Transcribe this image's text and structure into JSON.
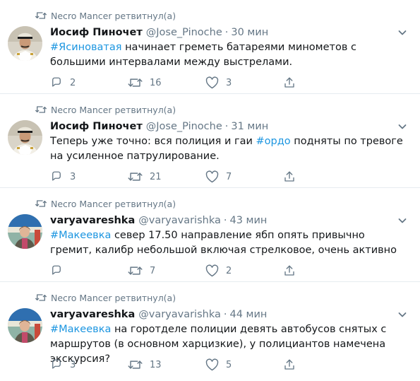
{
  "tweets": [
    {
      "retweeted_by": "Necro Mancer ретвитнул(а)",
      "name": "Иосиф Пиночет",
      "handle": "@Jose_Pinoche",
      "dot": "·",
      "time": "30 мин",
      "hashtag": "#Ясиноватая",
      "text_before": "",
      "text_after": " начинает  греметь батареями минометов с большими интервалами между выстрелами.",
      "replies": "2",
      "retweets": "16",
      "likes": "3",
      "avatar": "military-officer-avatar"
    },
    {
      "retweeted_by": "Necro Mancer ретвитнул(а)",
      "name": "Иосиф Пиночет",
      "handle": "@Jose_Pinoche",
      "dot": "·",
      "time": "31 мин",
      "hashtag": "#ордо",
      "text_before": "Теперь уже точно: вся полиция и гаи ",
      "text_after": " подняты по тревоге на усиленное патрулирование.",
      "replies": "3",
      "retweets": "21",
      "likes": "7",
      "avatar": "military-officer-avatar"
    },
    {
      "retweeted_by": "Necro Mancer ретвитнул(а)",
      "name": "varyavareshka",
      "handle": "@varyavarishka",
      "dot": "·",
      "time": "43 мин",
      "hashtag": "#Макеевка",
      "text_before": "",
      "text_after": " север 17.50 направление ябп опять привычно гремит, калибр небольшой включая стрелковое, очень активно",
      "replies": "",
      "retweets": "7",
      "likes": "2",
      "avatar": "woman-portrait-avatar"
    },
    {
      "retweeted_by": "Necro Mancer ретвитнул(а)",
      "name": "varyavareshka",
      "handle": "@varyavarishka",
      "dot": "·",
      "time": "44 мин",
      "hashtag": "#Макеевка",
      "text_before": "",
      "text_after": " на горотделе полиции девять автобусов снятых с маршрутов (в основном харцизкие), у полициантов намечена экскурсия?",
      "replies": "3",
      "retweets": "13",
      "likes": "5",
      "avatar": "woman-portrait-avatar"
    }
  ],
  "colors": {
    "text": "#14171a",
    "secondary": "#657786",
    "hashtag": "#1b95e0",
    "divider": "#e6ecf0"
  },
  "icons": {
    "retweeted": "retweet-icon",
    "reply": "reply-icon",
    "retweet": "retweet-icon",
    "like": "heart-icon",
    "share": "share-icon",
    "menu": "chevron-down-icon"
  }
}
